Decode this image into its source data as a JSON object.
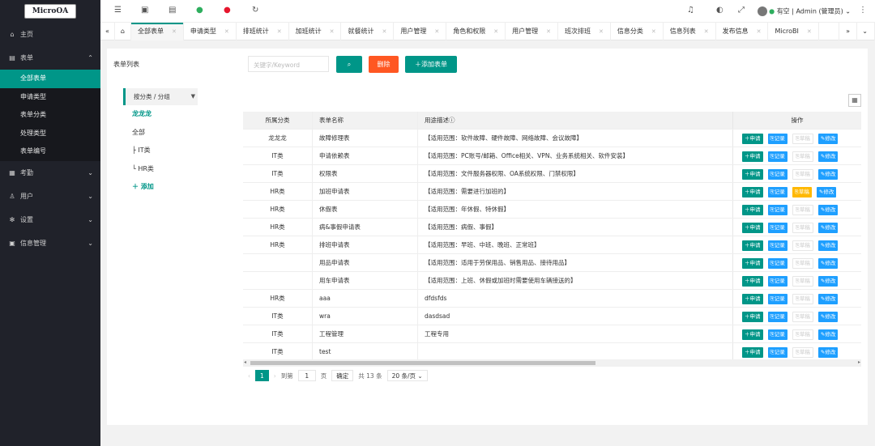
{
  "logo": "MicroOA",
  "sidebar": {
    "items": [
      {
        "icon": "home-icon",
        "glyph": "⌂",
        "label": "主页"
      },
      {
        "icon": "form-icon",
        "glyph": "▤",
        "label": "表单"
      }
    ],
    "sub": [
      "全部表单",
      "申请类型",
      "表单分类",
      "处理类型",
      "表单编号"
    ],
    "items2": [
      {
        "icon": "attendance-icon",
        "glyph": "▦",
        "label": "考勤"
      },
      {
        "icon": "user-icon",
        "glyph": "♙",
        "label": "用户"
      },
      {
        "icon": "settings-icon",
        "glyph": "✻",
        "label": "设置"
      },
      {
        "icon": "info-icon",
        "glyph": "▣",
        "label": "信息管理"
      }
    ]
  },
  "header": {
    "user": "有空 | Admin (管理员)"
  },
  "tabs": [
    "全部表单",
    "申请类型",
    "排班统计",
    "加班统计",
    "就餐统计",
    "用户管理",
    "角色和权限",
    "用户管理",
    "班次排班",
    "信息分类",
    "信息列表",
    "发布信息",
    "MicroBI"
  ],
  "main": {
    "title": "表单列表",
    "search_placeholder": "关键字/Keyword",
    "delete": "删除",
    "add": "＋添加表单"
  },
  "tree": {
    "head": "按分类 / 分组",
    "items": [
      "龙龙龙",
      "全部",
      "├ IT类",
      "└ HR类",
      "＋ 添加"
    ]
  },
  "table": {
    "headers": [
      "所属分类",
      "表单名称",
      "用途描述ⓘ",
      "操作"
    ],
    "ops": [
      "＋申请",
      "⎘记录",
      "⎘草稿",
      "✎修改"
    ],
    "rows": [
      [
        "龙龙龙",
        "故障修理表",
        "【适用范围：软件故障、硬件故障、网络故障、会议故障】",
        false
      ],
      [
        "IT类",
        "申请依赖表",
        "【适用范围：PC账号/邮箱、Office相关、VPN、业务系统相关、软件安装】",
        false
      ],
      [
        "IT类",
        "权限表",
        "【适用范围：文件服务器权限、OA系统权限、门禁权限】",
        false
      ],
      [
        "HR类",
        "加班申请表",
        "【适用范围：需要进行加班的】",
        true
      ],
      [
        "HR类",
        "休假表",
        "【适用范围：年休假、特休假】",
        false
      ],
      [
        "HR类",
        "病&事假申请表",
        "【适用范围：病假、事假】",
        false
      ],
      [
        "HR类",
        "排班申请表",
        "【适用范围：早班、中班、晚班、正常班】",
        false
      ],
      [
        "",
        "用品申请表",
        "【适用范围：适用于劳保用品、销售用品、接待用品】",
        false
      ],
      [
        "",
        "用车申请表",
        "【适用范围：上班、休假或加班时需要使用车辆接送的】",
        false
      ],
      [
        "HR类",
        "aaa",
        "dfdsfds",
        false
      ],
      [
        "IT类",
        "wra",
        "dasdsad",
        false
      ],
      [
        "IT类",
        "工程管理",
        "工程专用",
        false
      ],
      [
        "IT类",
        "test",
        "",
        false
      ]
    ]
  },
  "pager": {
    "page": "1",
    "goto": "到第",
    "page_input": "1",
    "unit": "页",
    "confirm": "确定",
    "total": "共 13 条",
    "size": "20 条/页 ⌄"
  }
}
